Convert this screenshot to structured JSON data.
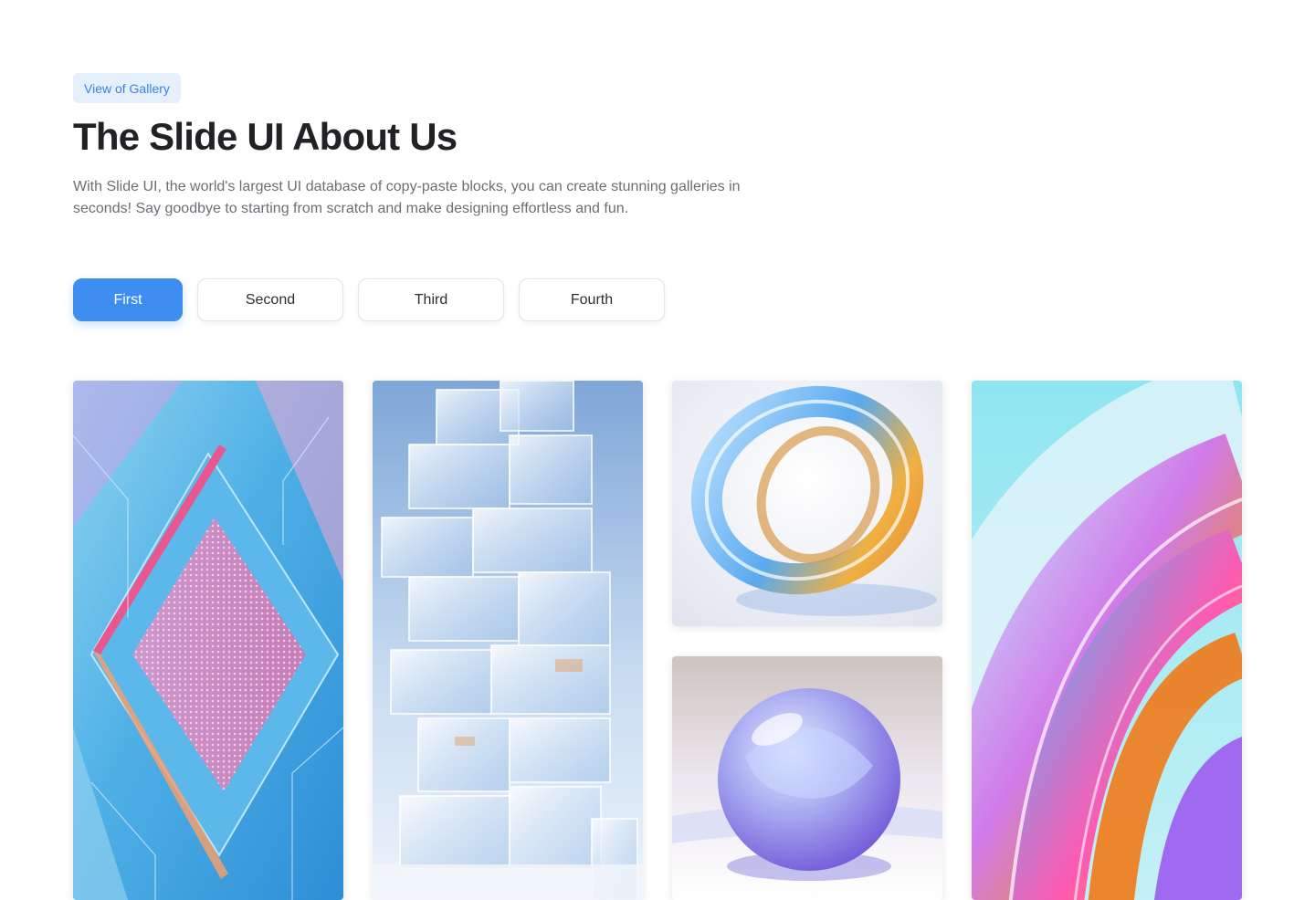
{
  "header": {
    "badge": "View of Gallery",
    "title": "The Slide UI About Us",
    "description": "With Slide UI, the world's largest UI database of copy-paste blocks, you can create stunning galleries in seconds! Say goodbye to starting from scratch and make designing effortless and fun."
  },
  "tabs": [
    {
      "label": "First",
      "active": true
    },
    {
      "label": "Second",
      "active": false
    },
    {
      "label": "Third",
      "active": false
    },
    {
      "label": "Fourth",
      "active": false
    }
  ],
  "gallery": {
    "images": [
      {
        "name": "circuit-board-image"
      },
      {
        "name": "glass-cubes-tower-image"
      },
      {
        "name": "glass-torus-ring-image"
      },
      {
        "name": "glass-sphere-image"
      },
      {
        "name": "iridescent-swirl-image"
      }
    ]
  },
  "colors": {
    "accent": "#3d8ef0",
    "badge_bg": "#e6f0fc",
    "badge_text": "#3b82e6"
  }
}
